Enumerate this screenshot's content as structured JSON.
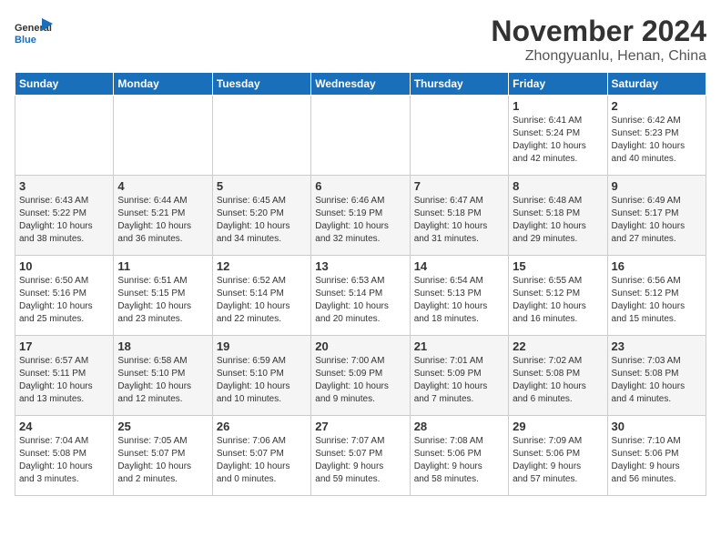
{
  "logo": {
    "line1": "General",
    "line2": "Blue"
  },
  "title": "November 2024",
  "subtitle": "Zhongyuanlu, Henan, China",
  "headers": [
    "Sunday",
    "Monday",
    "Tuesday",
    "Wednesday",
    "Thursday",
    "Friday",
    "Saturday"
  ],
  "weeks": [
    [
      {
        "day": "",
        "info": ""
      },
      {
        "day": "",
        "info": ""
      },
      {
        "day": "",
        "info": ""
      },
      {
        "day": "",
        "info": ""
      },
      {
        "day": "",
        "info": ""
      },
      {
        "day": "1",
        "info": "Sunrise: 6:41 AM\nSunset: 5:24 PM\nDaylight: 10 hours\nand 42 minutes."
      },
      {
        "day": "2",
        "info": "Sunrise: 6:42 AM\nSunset: 5:23 PM\nDaylight: 10 hours\nand 40 minutes."
      }
    ],
    [
      {
        "day": "3",
        "info": "Sunrise: 6:43 AM\nSunset: 5:22 PM\nDaylight: 10 hours\nand 38 minutes."
      },
      {
        "day": "4",
        "info": "Sunrise: 6:44 AM\nSunset: 5:21 PM\nDaylight: 10 hours\nand 36 minutes."
      },
      {
        "day": "5",
        "info": "Sunrise: 6:45 AM\nSunset: 5:20 PM\nDaylight: 10 hours\nand 34 minutes."
      },
      {
        "day": "6",
        "info": "Sunrise: 6:46 AM\nSunset: 5:19 PM\nDaylight: 10 hours\nand 32 minutes."
      },
      {
        "day": "7",
        "info": "Sunrise: 6:47 AM\nSunset: 5:18 PM\nDaylight: 10 hours\nand 31 minutes."
      },
      {
        "day": "8",
        "info": "Sunrise: 6:48 AM\nSunset: 5:18 PM\nDaylight: 10 hours\nand 29 minutes."
      },
      {
        "day": "9",
        "info": "Sunrise: 6:49 AM\nSunset: 5:17 PM\nDaylight: 10 hours\nand 27 minutes."
      }
    ],
    [
      {
        "day": "10",
        "info": "Sunrise: 6:50 AM\nSunset: 5:16 PM\nDaylight: 10 hours\nand 25 minutes."
      },
      {
        "day": "11",
        "info": "Sunrise: 6:51 AM\nSunset: 5:15 PM\nDaylight: 10 hours\nand 23 minutes."
      },
      {
        "day": "12",
        "info": "Sunrise: 6:52 AM\nSunset: 5:14 PM\nDaylight: 10 hours\nand 22 minutes."
      },
      {
        "day": "13",
        "info": "Sunrise: 6:53 AM\nSunset: 5:14 PM\nDaylight: 10 hours\nand 20 minutes."
      },
      {
        "day": "14",
        "info": "Sunrise: 6:54 AM\nSunset: 5:13 PM\nDaylight: 10 hours\nand 18 minutes."
      },
      {
        "day": "15",
        "info": "Sunrise: 6:55 AM\nSunset: 5:12 PM\nDaylight: 10 hours\nand 16 minutes."
      },
      {
        "day": "16",
        "info": "Sunrise: 6:56 AM\nSunset: 5:12 PM\nDaylight: 10 hours\nand 15 minutes."
      }
    ],
    [
      {
        "day": "17",
        "info": "Sunrise: 6:57 AM\nSunset: 5:11 PM\nDaylight: 10 hours\nand 13 minutes."
      },
      {
        "day": "18",
        "info": "Sunrise: 6:58 AM\nSunset: 5:10 PM\nDaylight: 10 hours\nand 12 minutes."
      },
      {
        "day": "19",
        "info": "Sunrise: 6:59 AM\nSunset: 5:10 PM\nDaylight: 10 hours\nand 10 minutes."
      },
      {
        "day": "20",
        "info": "Sunrise: 7:00 AM\nSunset: 5:09 PM\nDaylight: 10 hours\nand 9 minutes."
      },
      {
        "day": "21",
        "info": "Sunrise: 7:01 AM\nSunset: 5:09 PM\nDaylight: 10 hours\nand 7 minutes."
      },
      {
        "day": "22",
        "info": "Sunrise: 7:02 AM\nSunset: 5:08 PM\nDaylight: 10 hours\nand 6 minutes."
      },
      {
        "day": "23",
        "info": "Sunrise: 7:03 AM\nSunset: 5:08 PM\nDaylight: 10 hours\nand 4 minutes."
      }
    ],
    [
      {
        "day": "24",
        "info": "Sunrise: 7:04 AM\nSunset: 5:08 PM\nDaylight: 10 hours\nand 3 minutes."
      },
      {
        "day": "25",
        "info": "Sunrise: 7:05 AM\nSunset: 5:07 PM\nDaylight: 10 hours\nand 2 minutes."
      },
      {
        "day": "26",
        "info": "Sunrise: 7:06 AM\nSunset: 5:07 PM\nDaylight: 10 hours\nand 0 minutes."
      },
      {
        "day": "27",
        "info": "Sunrise: 7:07 AM\nSunset: 5:07 PM\nDaylight: 9 hours\nand 59 minutes."
      },
      {
        "day": "28",
        "info": "Sunrise: 7:08 AM\nSunset: 5:06 PM\nDaylight: 9 hours\nand 58 minutes."
      },
      {
        "day": "29",
        "info": "Sunrise: 7:09 AM\nSunset: 5:06 PM\nDaylight: 9 hours\nand 57 minutes."
      },
      {
        "day": "30",
        "info": "Sunrise: 7:10 AM\nSunset: 5:06 PM\nDaylight: 9 hours\nand 56 minutes."
      }
    ]
  ]
}
